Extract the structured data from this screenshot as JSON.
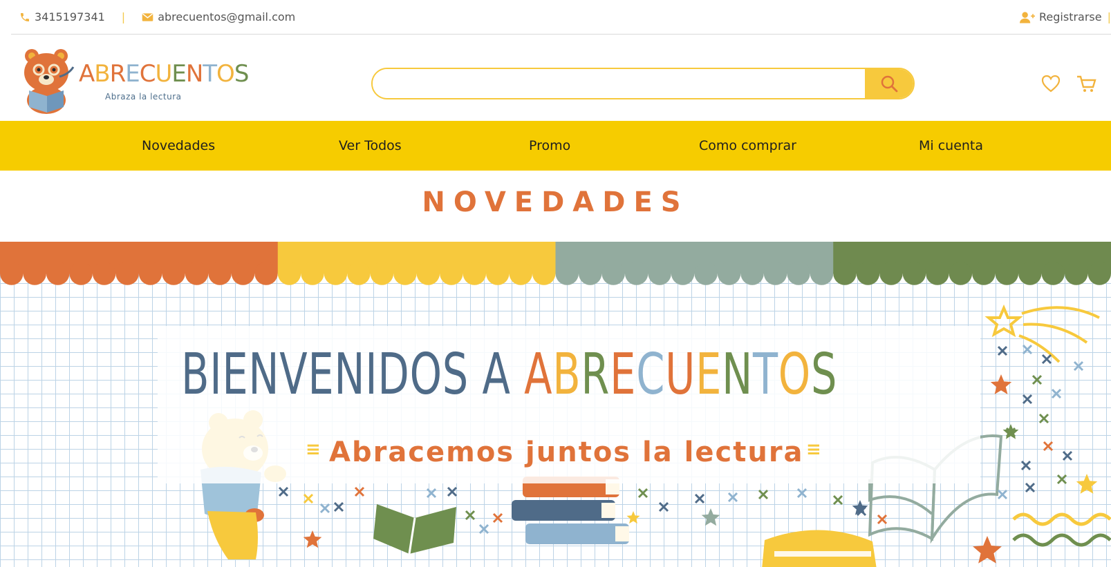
{
  "topbar": {
    "phone": "3415197341",
    "separator": "|",
    "email": "abrecuentos@gmail.com",
    "register": "Registrarse",
    "register_bar": "|"
  },
  "logo": {
    "letters": [
      "A",
      "B",
      "R",
      "E",
      "C",
      "U",
      "E",
      "N",
      "T",
      "O",
      "S"
    ],
    "letter_colors": [
      "#e0733a",
      "#f2b33d",
      "#e0733a",
      "#8fb3cf",
      "#e0733a",
      "#f2b33d",
      "#6f8f4f",
      "#e0733a",
      "#8fb3cf",
      "#f2b33d",
      "#6f8f4f"
    ],
    "tagline": "Abraza la lectura"
  },
  "search": {
    "value": "",
    "placeholder": ""
  },
  "header_icons": [
    "heart-icon",
    "cart-icon"
  ],
  "nav": {
    "items": [
      "Novedades",
      "Ver Todos",
      "Promo",
      "Como comprar",
      "Mi cuenta"
    ]
  },
  "section": {
    "title": "NOVEDADES"
  },
  "banner": {
    "welcome_prefix": "BIENVENIDOS A ",
    "welcome_brand": [
      "A",
      "B",
      "R",
      "E",
      "C",
      "U",
      "E",
      "N",
      "T",
      "O",
      "S"
    ],
    "brand_colors": [
      "#e0733a",
      "#f2b33d",
      "#6f8f4f",
      "#e0733a",
      "#8fb3cf",
      "#e0733a",
      "#f2b33d",
      "#6f8f4f",
      "#8fb3cf",
      "#f2b33d",
      "#6f8f4f"
    ],
    "slogan": "Abracemos juntos la lectura",
    "awning_colors": [
      "#e0733a",
      "#f7c93d",
      "#93ab9f",
      "#6f8a4f"
    ]
  },
  "colors": {
    "accent_yellow": "#f6cc00",
    "accent_orange": "#e0733a",
    "search_border": "#f7c93d"
  }
}
